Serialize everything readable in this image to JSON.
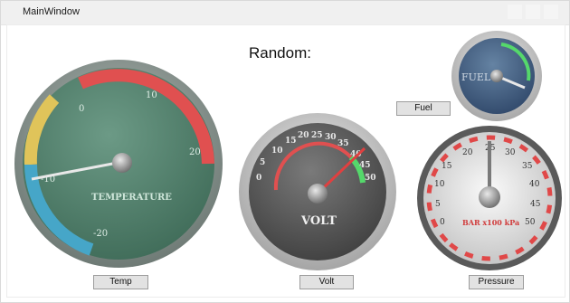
{
  "window": {
    "title": "MainWindow"
  },
  "heading": "Random:",
  "buttons": {
    "temp": "Temp",
    "volt": "Volt",
    "fuel": "Fuel",
    "pressure": "Pressure"
  },
  "gauges": {
    "temperature": {
      "label": "TEMPERATURE",
      "ticks": [
        "-20",
        "-10",
        "0",
        "10",
        "20"
      ]
    },
    "volt": {
      "label": "VOLT",
      "ticks": [
        "0",
        "5",
        "10",
        "15",
        "20",
        "25",
        "30",
        "35",
        "40",
        "45",
        "50"
      ]
    },
    "fuel": {
      "label": "FUEL"
    },
    "pressure": {
      "label": "BAR x100 kPa",
      "ticks": [
        "0",
        "5",
        "10",
        "15",
        "20",
        "25",
        "30",
        "35",
        "40",
        "45",
        "50"
      ]
    }
  },
  "colors": {
    "temp_face": "#4f7f6b",
    "volt_face": "#5b5b5b",
    "fuel_face": "#3f5d7d",
    "pressure_face": "#d9d9d9",
    "red_band": "#e05050",
    "green_band": "#55d86b",
    "yellow_band": "#e0c45a",
    "blue_band": "#46a6c8"
  }
}
